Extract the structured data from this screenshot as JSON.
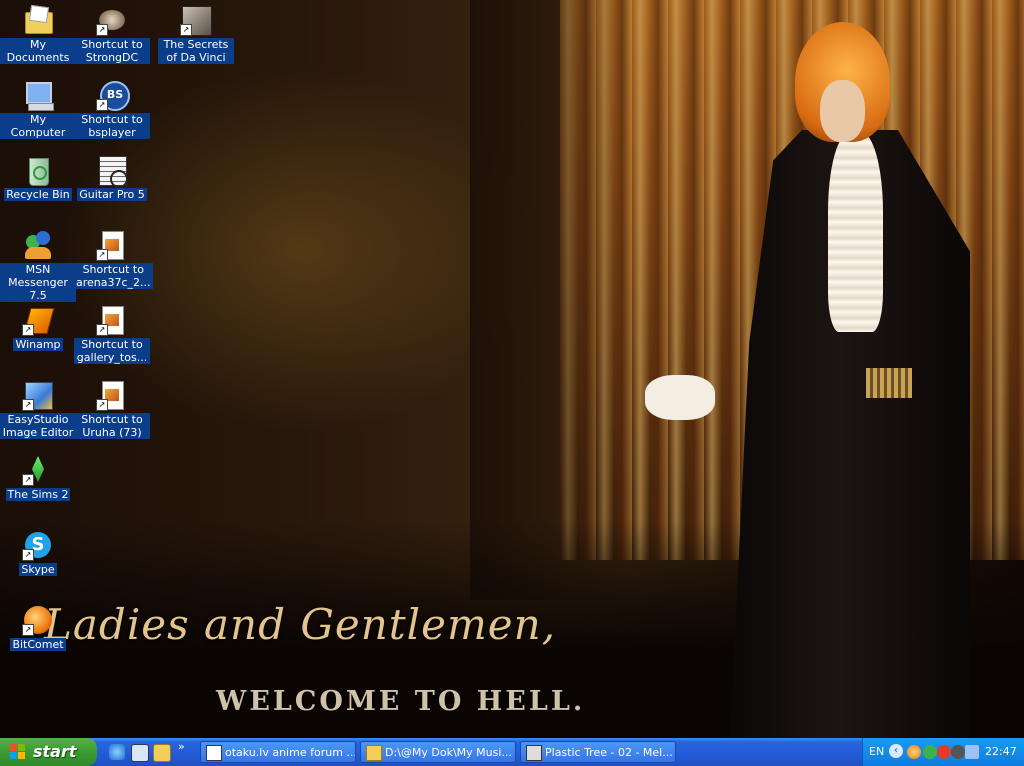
{
  "desktop_icons": [
    {
      "name": "my-documents",
      "label": "My Documents"
    },
    {
      "name": "shortcut-strongdc",
      "label": "Shortcut to StrongDC"
    },
    {
      "name": "secrets-of-da-vinci",
      "label": "The Secrets of Da Vinci"
    },
    {
      "name": "my-computer",
      "label": "My Computer"
    },
    {
      "name": "shortcut-bsplayer",
      "label": "Shortcut to bsplayer"
    },
    {
      "name": "recycle-bin",
      "label": "Recycle Bin"
    },
    {
      "name": "guitar-pro-5",
      "label": "Guitar Pro 5"
    },
    {
      "name": "msn-messenger",
      "label": "MSN Messenger 7.5"
    },
    {
      "name": "shortcut-arena37c",
      "label": "Shortcut to arena37c_2..."
    },
    {
      "name": "winamp",
      "label": "Winamp"
    },
    {
      "name": "shortcut-gallery-tos",
      "label": "Shortcut to gallery_tos..."
    },
    {
      "name": "easystudio-image-editor",
      "label": "EasyStudio Image Editor"
    },
    {
      "name": "shortcut-uruha-73",
      "label": "Shortcut to Uruha (73)"
    },
    {
      "name": "the-sims-2",
      "label": "The Sims 2"
    },
    {
      "name": "skype",
      "label": "Skype"
    },
    {
      "name": "bitcomet",
      "label": "BitComet"
    }
  ],
  "wallpaper": {
    "script_text": "Ladies and Gentlemen,",
    "subtitle": "WELCOME TO HELL."
  },
  "taskbar": {
    "start_label": "start",
    "quick_launch": [
      {
        "name": "internet-explorer-icon"
      },
      {
        "name": "show-desktop-icon"
      },
      {
        "name": "folder-icon"
      }
    ],
    "overflow": "»",
    "tasks": [
      {
        "name": "task-otaku-forum",
        "label": "otaku.lv anime forum ...",
        "icon": "browser-icon"
      },
      {
        "name": "task-explorer-folder",
        "label": "D:\\@My Dok\\My Musi...",
        "icon": "folder-icon"
      },
      {
        "name": "task-plastic-tree",
        "label": "Plastic Tree - 02 - Mel...",
        "icon": "media-player-icon"
      }
    ],
    "tray": {
      "language": "EN",
      "clock": "22:47"
    }
  },
  "colors": {
    "taskbar_blue": "#245edb",
    "start_green": "#3c9a32",
    "tray_blue": "#0f7be0",
    "icon_label_bg": "#0b3e8a"
  }
}
